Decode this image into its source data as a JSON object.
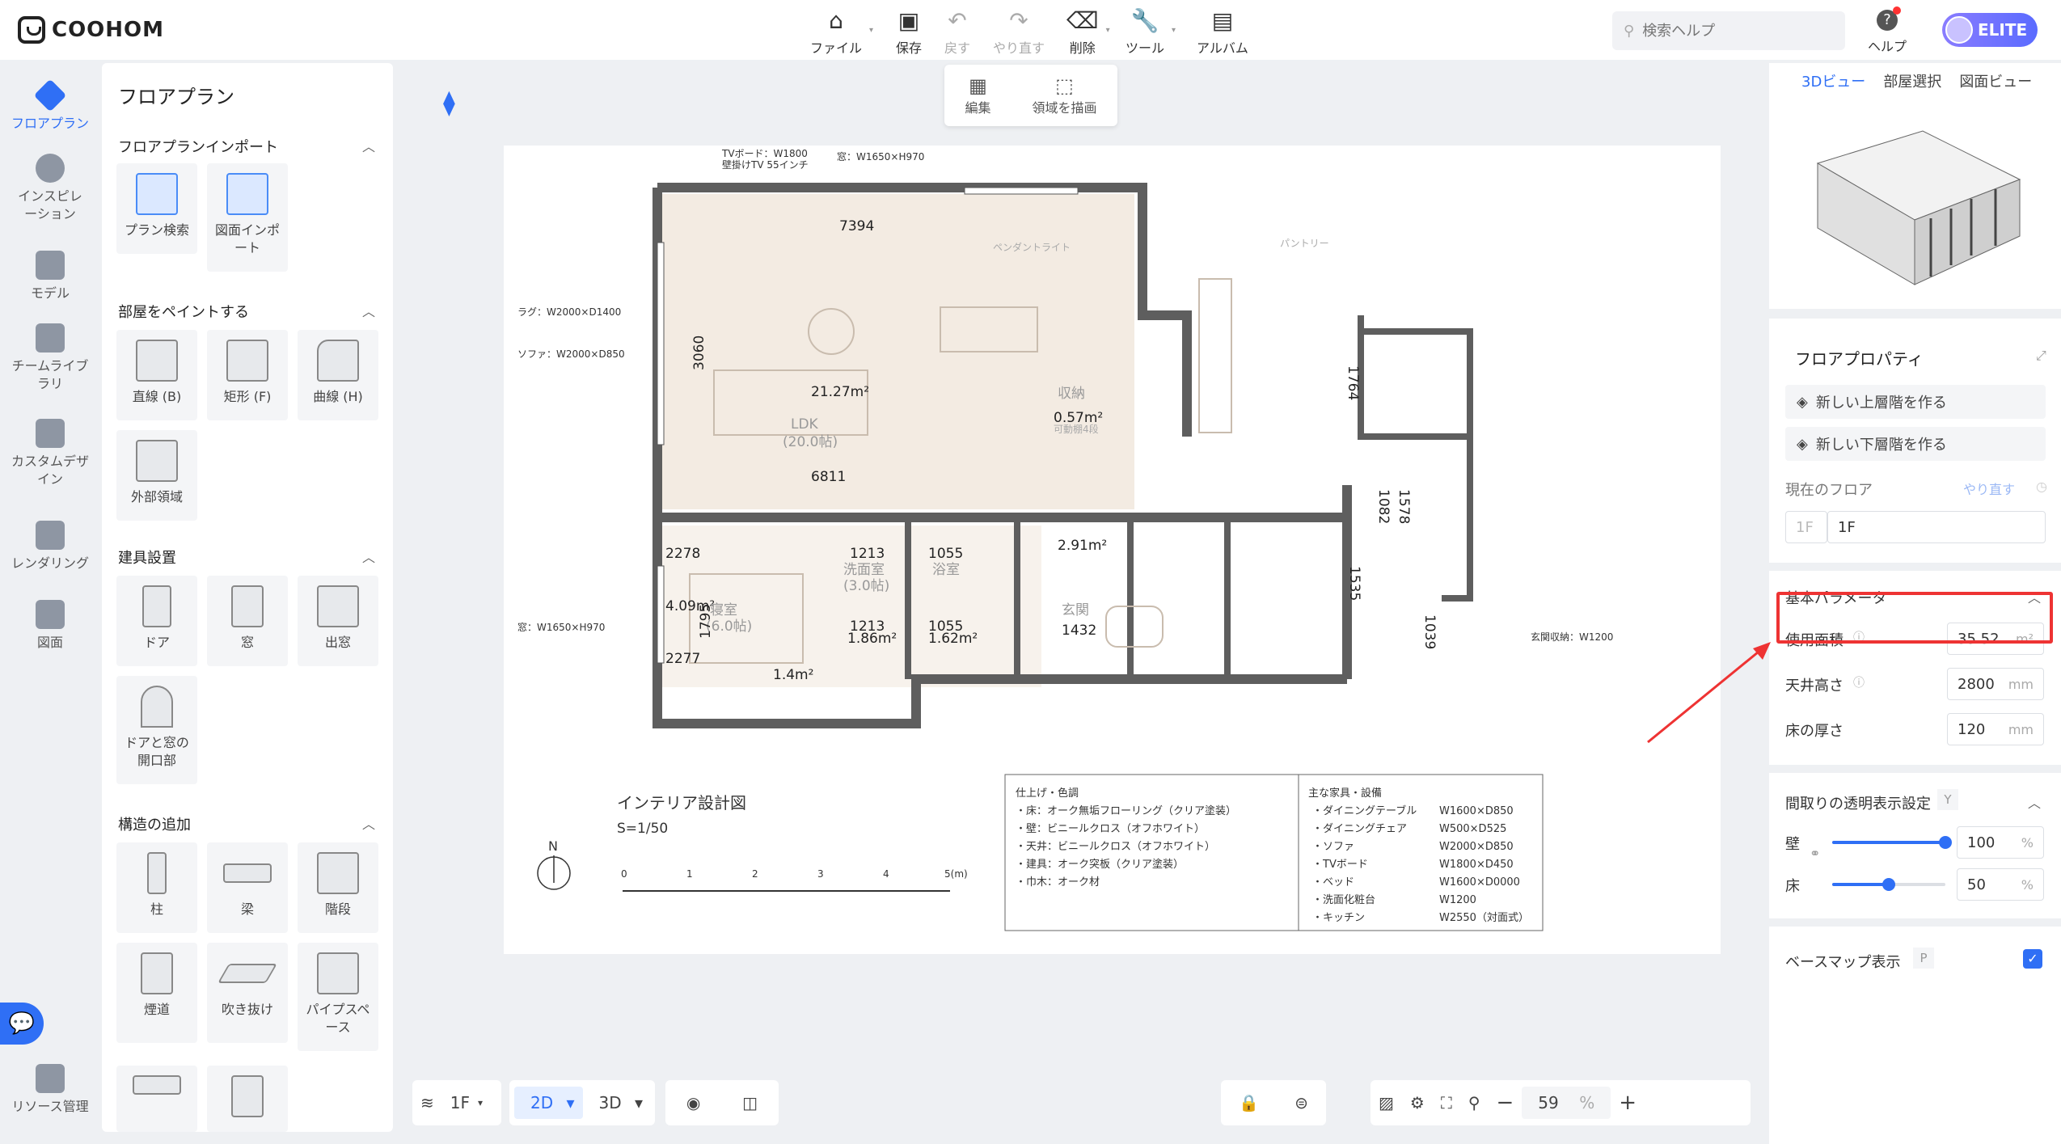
{
  "app": {
    "logo": "COOHOM"
  },
  "toolbar": {
    "file": "ファイル",
    "save": "保存",
    "undo": "戻す",
    "redo": "やり直す",
    "delete": "削除",
    "tools": "ツール",
    "album": "アルバム"
  },
  "search": {
    "placeholder": "検索ヘルプ"
  },
  "help": {
    "label": "ヘルプ"
  },
  "account": {
    "badge": "ELITE"
  },
  "leftnav": {
    "items": [
      {
        "label": "フロアプラン"
      },
      {
        "label": "インスピレーション"
      },
      {
        "label": "モデル"
      },
      {
        "label": "チームライブラリ"
      },
      {
        "label": "カスタムデザイン"
      },
      {
        "label": "レンダリング"
      },
      {
        "label": "図面"
      },
      {
        "label": "リソース管理"
      }
    ]
  },
  "panel": {
    "title": "フロアプラン",
    "import": {
      "title": "フロアプランインポート",
      "items": [
        "プラン検索",
        "図面インポート"
      ]
    },
    "paint": {
      "title": "部屋をペイントする",
      "items": [
        "直線 (B)",
        "矩形 (F)",
        "曲線 (H)",
        "外部領域"
      ]
    },
    "fixtures": {
      "title": "建具設置",
      "items": [
        "ドア",
        "窓",
        "出窓",
        "ドアと窓の開口部"
      ]
    },
    "structure": {
      "title": "構造の追加",
      "items": [
        "柱",
        "梁",
        "階段",
        "煙道",
        "吹き抜け",
        "パイプスペース"
      ]
    }
  },
  "floattool": {
    "edit": "編集",
    "draw": "領域を描画"
  },
  "bottom": {
    "floor": "1F",
    "mode2d": "2D",
    "mode3d": "3D",
    "zoom": "59",
    "zoom_unit": "%"
  },
  "right": {
    "tabs": [
      "3Dビュー",
      "部屋選択",
      "図面ビュー"
    ],
    "props_title": "フロアプロパティ",
    "btn_upper": "新しい上層階を作る",
    "btn_lower": "新しい下層階を作る",
    "current_floor_label": "現在のフロア",
    "redo": "やり直す",
    "floor_prefix": "1F",
    "floor_value": "1F",
    "basic_title": "基本パラメータ",
    "area_label": "使用面積",
    "area_value": "35.52",
    "area_unit": "m²",
    "ceiling_label": "天井高さ",
    "ceiling_value": "2800",
    "thickness_label": "床の厚さ",
    "thickness_value": "120",
    "mm": "mm",
    "transparency_title": "間取りの透明表示設定",
    "transparency_key": "Y",
    "wall_label": "壁",
    "wall_value": "100",
    "wall_level": 1.0,
    "floor_label": "床",
    "floor_opacity": "50",
    "floor_level": 0.5,
    "pct": "%",
    "basemap_label": "ベースマップ表示",
    "basemap_key": "P"
  },
  "plan": {
    "title": "インテリア設計図",
    "scale": "S=1/50",
    "north": "N",
    "scale_ticks": [
      "0",
      "1",
      "2",
      "3",
      "4",
      "5(m)"
    ],
    "ldk": "LDK",
    "ldk_tatami": "(20.0帖)",
    "ldk_area": "21.27m²",
    "dim_7394": "7394",
    "dim_6811": "6811",
    "dim_3060": "3060",
    "dim_1764": "1764",
    "dim_1082": "1082",
    "dim_1578": "1578",
    "storage": "収納",
    "storage_area": "0.57m²",
    "storage_note": "可動棚4段",
    "bedroom": "寝室",
    "bedroom_tatami": "(6.0帖)",
    "bedroom_area": "4.09m²",
    "dim_2278": "2278",
    "dim_2277": "2277",
    "dim_1795": "1795",
    "wic_area": "1.4m²",
    "washroom": "洗面室",
    "washroom_tatami": "(3.0帖)",
    "washroom_area": "1.86m²",
    "dim_1213a": "1213",
    "dim_1213b": "1213",
    "bath": "浴室",
    "bath_area": "1.62m²",
    "dim_1055a": "1055",
    "dim_1055b": "1055",
    "entrance": "玄関",
    "entrance_area": "2.91m²",
    "dim_1432": "1432",
    "dim_1039": "1039",
    "dim_1535": "1535",
    "pendant": "ペンダントライト",
    "pantry": "パントリー",
    "ann_tv": "TVボード：W1800",
    "ann_tv2": "壁掛けTV 55インチ",
    "ann_window_top": "窓：W1650×H970",
    "ann_rug": "ラグ：W2000×D1400",
    "ann_sofa": "ソファ：W2000×D850",
    "ann_window_left": "窓：W1650×H970",
    "ann_shoebox": "玄関収納：W1200",
    "finish_title": "仕上げ・色調",
    "finish": [
      "・床：オーク無垢フローリング（クリア塗装）",
      "・壁：ビニールクロス（オフホワイト）",
      "・天井：ビニールクロス（オフホワイト）",
      "・建具：オーク突板（クリア塗装）",
      "・巾木：オーク材"
    ],
    "furniture_title": "主な家具・設備",
    "furniture": [
      [
        "・ダイニングテーブル",
        "W1600×D850"
      ],
      [
        "・ダイニングチェア",
        "W500×D525"
      ],
      [
        "・ソファ",
        "W2000×D850"
      ],
      [
        "・TVボード",
        "W1800×D450"
      ],
      [
        "・ベッド",
        "W1600×D0000"
      ],
      [
        "・洗面化粧台",
        "W1200"
      ],
      [
        "・キッチン",
        "W2550（対面式）"
      ]
    ]
  },
  "colors": {
    "accent": "#2f6ff5",
    "highlight": "#e33",
    "wall": "#5e5e5e"
  }
}
